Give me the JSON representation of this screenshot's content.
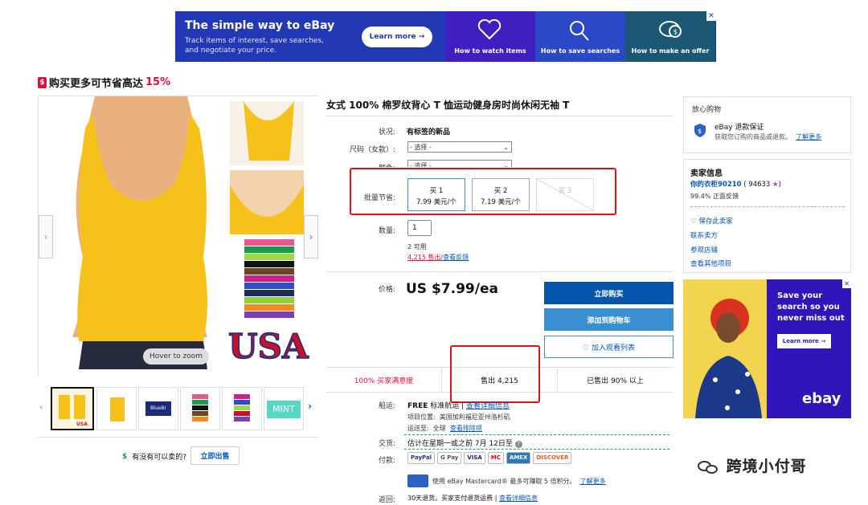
{
  "banner": {
    "title": "The simple way to eBay",
    "desc": "Track items of interest, save searches, and negotiate your price.",
    "learn_more": "Learn more →",
    "tiles": [
      "How to watch items",
      "How to save searches",
      "How to make an offer"
    ],
    "close": "✕"
  },
  "savebar": {
    "prefix": "购买更多可节省高达",
    "pct": "15%",
    "tag": "$"
  },
  "gallery": {
    "hover": "Hover to zoom",
    "usa": "USA",
    "color_chips": [
      "FUSCHIA",
      "KELLY",
      "LIME",
      "BLACK",
      "BROWN",
      "FUCHSIA",
      "ROYAL",
      "NAVY",
      "LIME",
      "ORANGE",
      "PURPLE"
    ],
    "thumbs_labels": [
      "",
      "",
      "BlueBr",
      "",
      "",
      "MINT"
    ]
  },
  "sell": {
    "question": "有没有可以卖的?",
    "button": "立即出售",
    "icon": "$"
  },
  "item": {
    "title": "女式 100% 棉罗纹背心 T 恤运动健身房时尚休闲无袖 T",
    "condition_label": "状况:",
    "condition_value": "有标签的新品",
    "size_label": "尺码（女款）:",
    "size_value": "- 选择 -",
    "color_label": "颜色:",
    "color_value": "- 选择 -",
    "bulk_label": "批量节省:",
    "bulk": [
      {
        "top": "买 1",
        "bottom": "7.99 美元/个"
      },
      {
        "top": "买 2",
        "bottom": "7.19 美元/个"
      },
      {
        "top": "买 3",
        "bottom": ""
      }
    ],
    "qty_label": "数量:",
    "qty_value": "1",
    "available": "2 可用",
    "sold_link": "4,215 售出",
    "feedback_link": "/查看反馈",
    "price_label": "价格:",
    "price": "US $7.99/ea",
    "buy_now": "立即购买",
    "add_cart": "添加到购物车",
    "watch": "♡ 加入观看列表",
    "stats": [
      "100% 买家满意度",
      "售出 4,215",
      "已售出 90% 以上"
    ],
    "ship_label": "船运:",
    "ship_free": "FREE",
    "ship_std": "标准航运 |",
    "ship_detail": "查看详细信息",
    "loc_label": "项目位置:",
    "loc_value": "美国加利福尼亚州洛杉矶",
    "to_label": "运送至:",
    "to_value": "全球",
    "to_link": "查看排除项",
    "deliv_label": "交货:",
    "deliv_value": "估计在星期一或之前 7月 12日至",
    "pay_label": "付款:",
    "payments": [
      "PayPal",
      "G Pay",
      "VISA",
      "MC",
      "AMEX",
      "DISCOVER"
    ],
    "card_text": "使用 eBay Mastercard® 最多可赚取 5 倍积分。",
    "card_link": "了解更多",
    "return_label": "返回:",
    "return_text": "30天退货。买家支付退货运费 |",
    "return_link": "查看详细信息"
  },
  "side": {
    "trust_title": "放心购物",
    "guarantee_title": "eBay 退款保证",
    "guarantee_desc": "获取您订购的商品或退款。",
    "guarantee_link": "了解更多",
    "seller_title": "卖家信息",
    "seller_name": "你的衣柜90210",
    "seller_score": "( 94633",
    "seller_score_end": ")",
    "positive": "99.4% 正面反馈",
    "save_seller": "保存此卖家",
    "contact": "联系卖方",
    "visit": "参观店铺",
    "other": "查看其他项目"
  },
  "ad": {
    "headline": "Save your search so you never miss out",
    "learn_more": "Learn more →",
    "logo": "ebay",
    "close": "✕"
  },
  "watermark": "跨境小付哥",
  "colors": {
    "ebay_blue": "#0655ad",
    "red": "#e0103a"
  }
}
